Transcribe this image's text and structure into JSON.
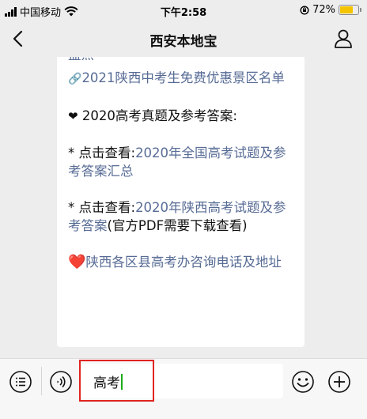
{
  "status_bar": {
    "carrier": "中国移动",
    "time": "下午2:58",
    "battery": "72%",
    "battery_level": 0.72
  },
  "header": {
    "title": "西安本地宝"
  },
  "message": {
    "truncated_line": "盘点",
    "link1_icon": "🔗",
    "link1": "2021陕西中考生免费优惠景区名单",
    "heading_icon": "❤",
    "heading": "2020高考真题及参考答案:",
    "item1_prefix": "* 点击查看:",
    "item1_link": "2020年全国高考试题及参考答案汇总",
    "item2_prefix": "* 点击查看:",
    "item2_link": "2020年陕西高考试题及参考答案",
    "item2_suffix": "(官方PDF需要下载查看)",
    "link2_icon": "❤️",
    "link2": "陕西各区县高考办咨询电话及地址"
  },
  "input_bar": {
    "value": "高考"
  },
  "icons": [
    "signal-icon",
    "wifi-icon",
    "rotation-lock-icon",
    "battery-icon",
    "back-icon",
    "profile-icon",
    "menu-list-icon",
    "voice-icon",
    "emoji-icon",
    "plus-icon",
    "link-icon",
    "heart-icon"
  ],
  "colors": {
    "link": "#576b95",
    "highlight": "#e0241f",
    "caret": "#1aad19",
    "battery": "#f5c400"
  }
}
